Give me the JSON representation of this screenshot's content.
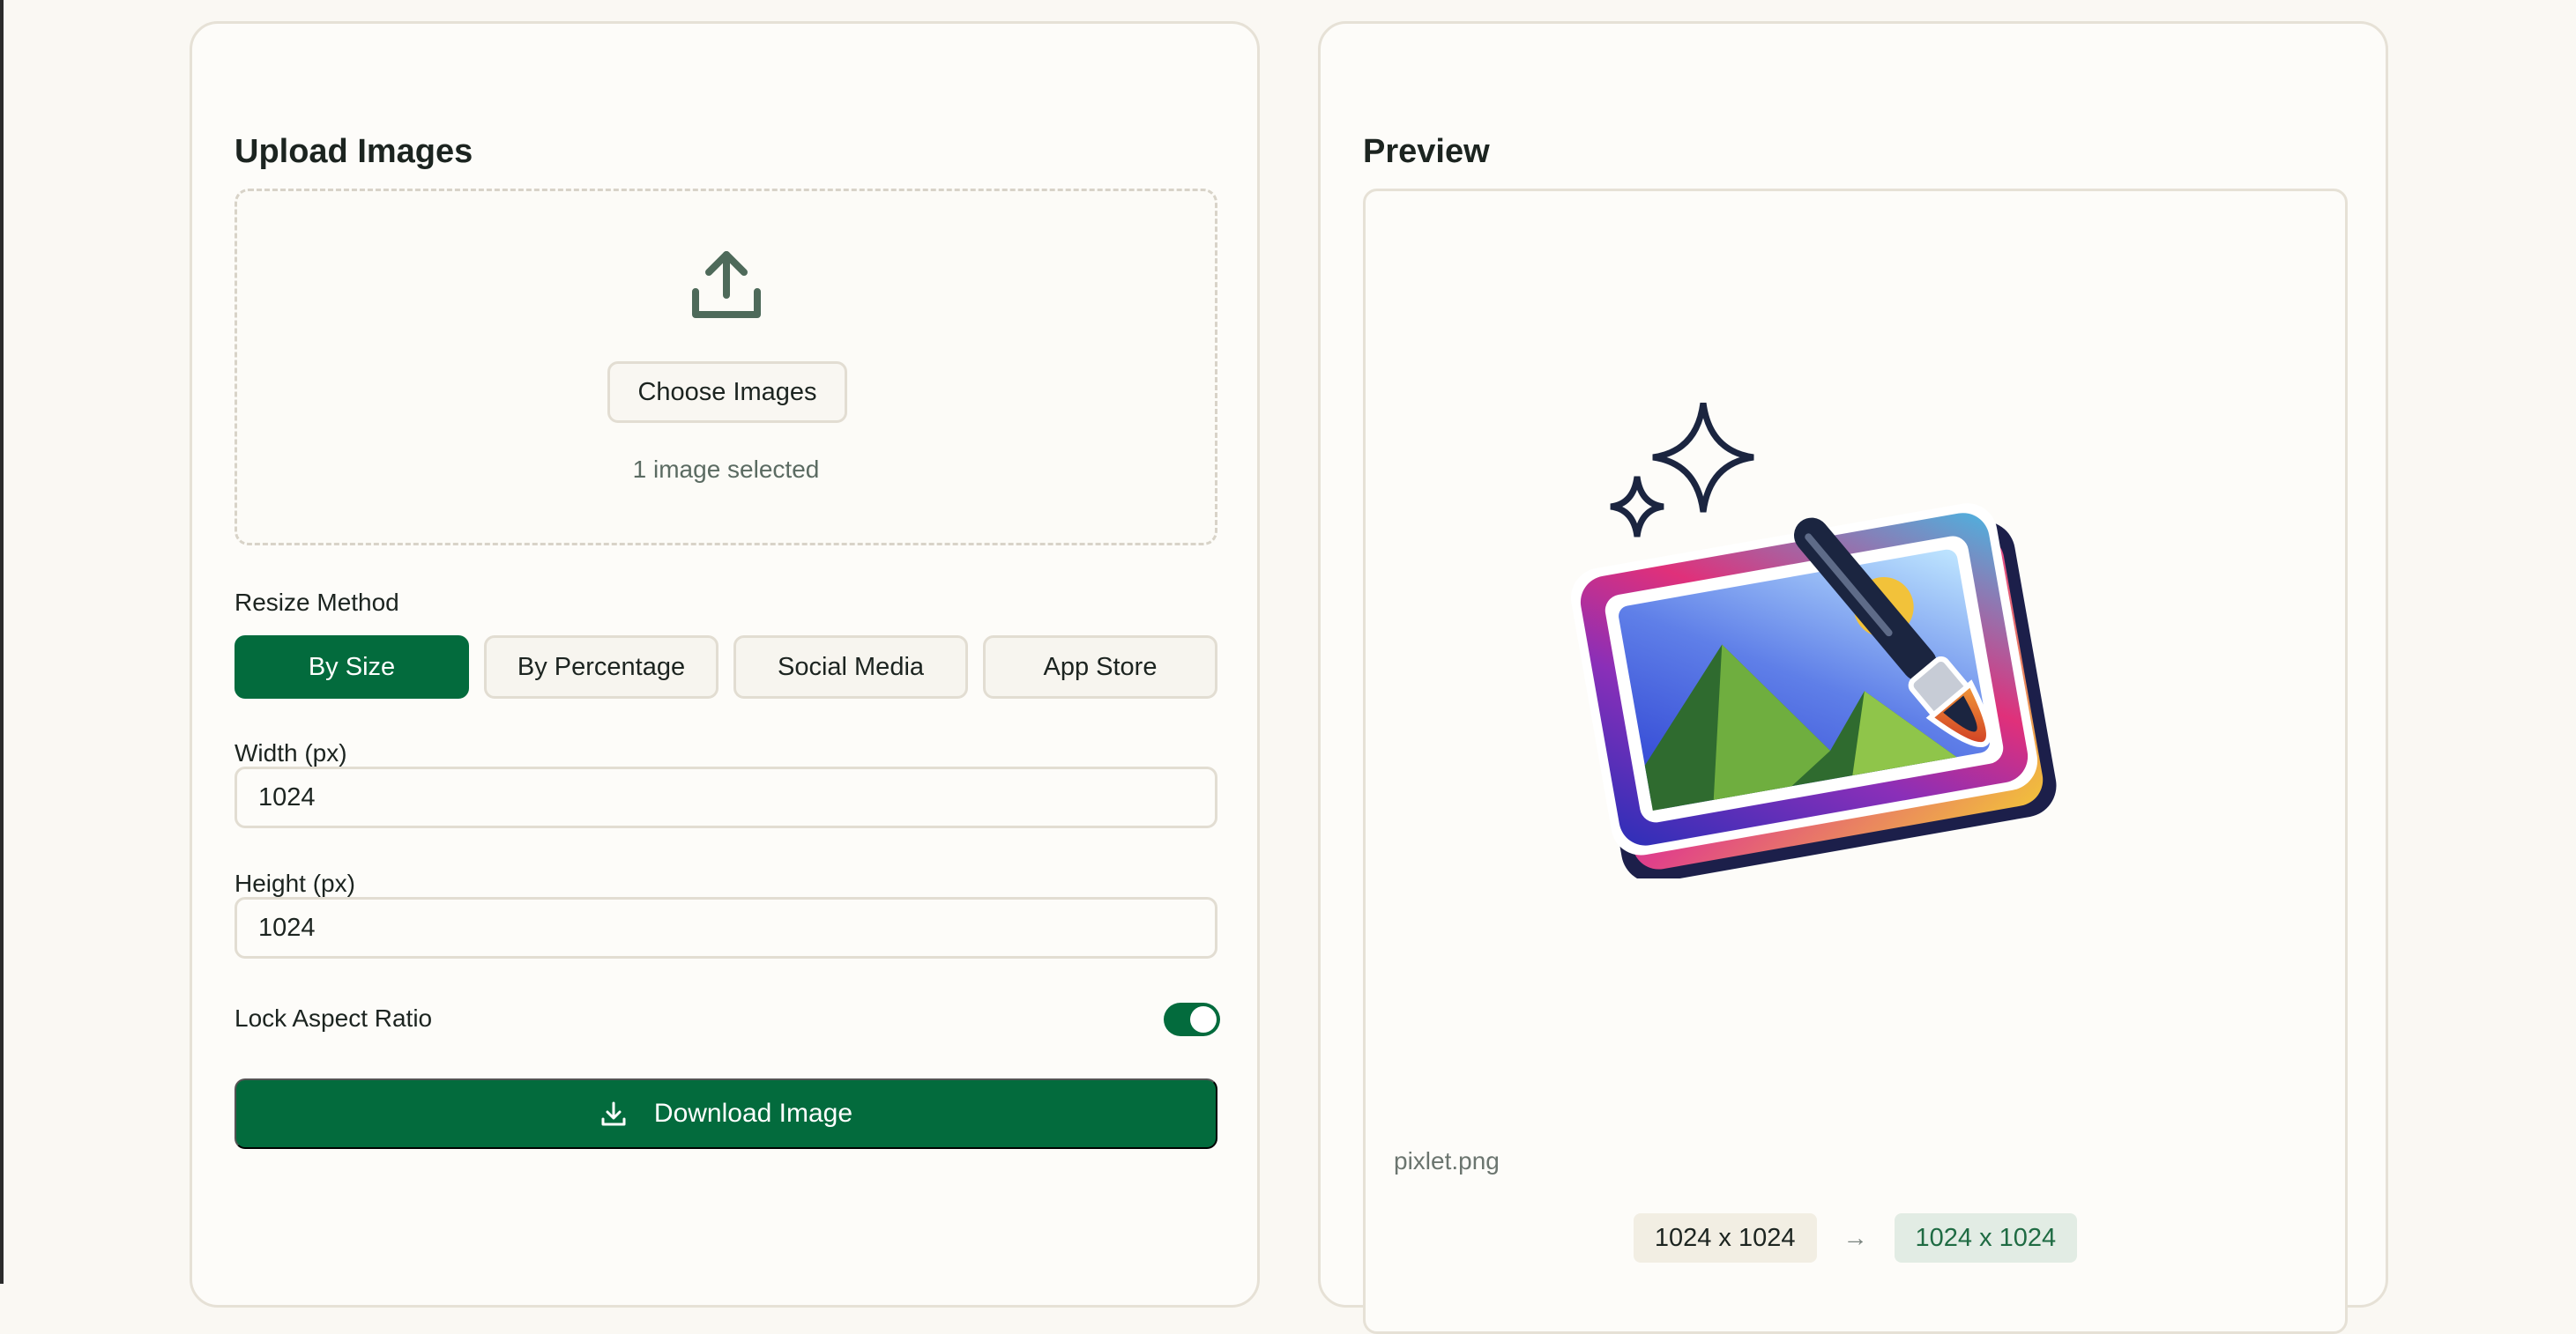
{
  "upload": {
    "title": "Upload Images",
    "choose_label": "Choose Images",
    "selected_text": "1 image selected"
  },
  "resize": {
    "label": "Resize Method",
    "methods": [
      "By Size",
      "By Percentage",
      "Social Media",
      "App Store"
    ],
    "active_method": "By Size"
  },
  "width": {
    "label": "Width (px)",
    "value": "1024"
  },
  "height": {
    "label": "Height (px)",
    "value": "1024"
  },
  "lock": {
    "label": "Lock Aspect Ratio",
    "enabled": true
  },
  "download": {
    "label": "Download Image",
    "icon": "download-icon"
  },
  "preview": {
    "title": "Preview",
    "filename": "pixlet.png",
    "original_dims": "1024 x 1024",
    "arrow": "→",
    "new_dims": "1024 x 1024"
  },
  "colors": {
    "accent": "#036b3d",
    "background": "#faf8f3",
    "card": "#fdfcf9"
  }
}
